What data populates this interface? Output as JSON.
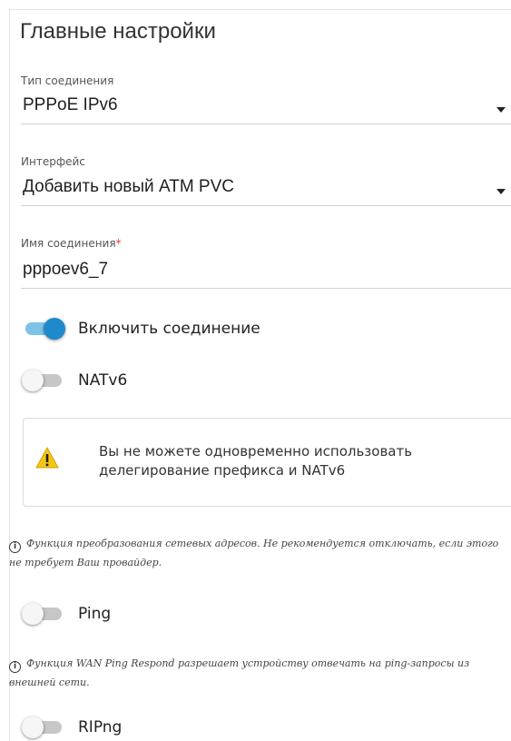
{
  "section": {
    "title": "Главные настройки"
  },
  "connection_type": {
    "label": "Тип соединения",
    "value": "PPPoE IPv6"
  },
  "interface": {
    "label": "Интерфейс",
    "value": "Добавить новый ATM PVC"
  },
  "connection_name": {
    "label": "Имя соединения",
    "required_mark": "*",
    "value": "pppoev6_7"
  },
  "toggles": {
    "enable_connection": {
      "label": "Включить соединение",
      "state": "on"
    },
    "natv6": {
      "label": "NATv6",
      "state": "off"
    },
    "ping": {
      "label": "Ping",
      "state": "off"
    },
    "ripng": {
      "label": "RIPng",
      "state": "off"
    }
  },
  "warning": {
    "icon": "warning-icon",
    "text": "Вы не можете одновременно использовать делегирование префикса и NATv6"
  },
  "hints": {
    "icon": "info-icon",
    "nat": "Функция преобразования сетевых адресов. Не рекомендуется отключать, если этого не требует Ваш провайдер.",
    "ping": "Функция WAN Ping Respond разрешает устройству отвечать на ping-запросы из внешней сети."
  },
  "colors": {
    "accent": "#1e8acc",
    "accent_light": "#7cc3e6",
    "required": "#e53935",
    "warning_fill": "#f5c518"
  }
}
